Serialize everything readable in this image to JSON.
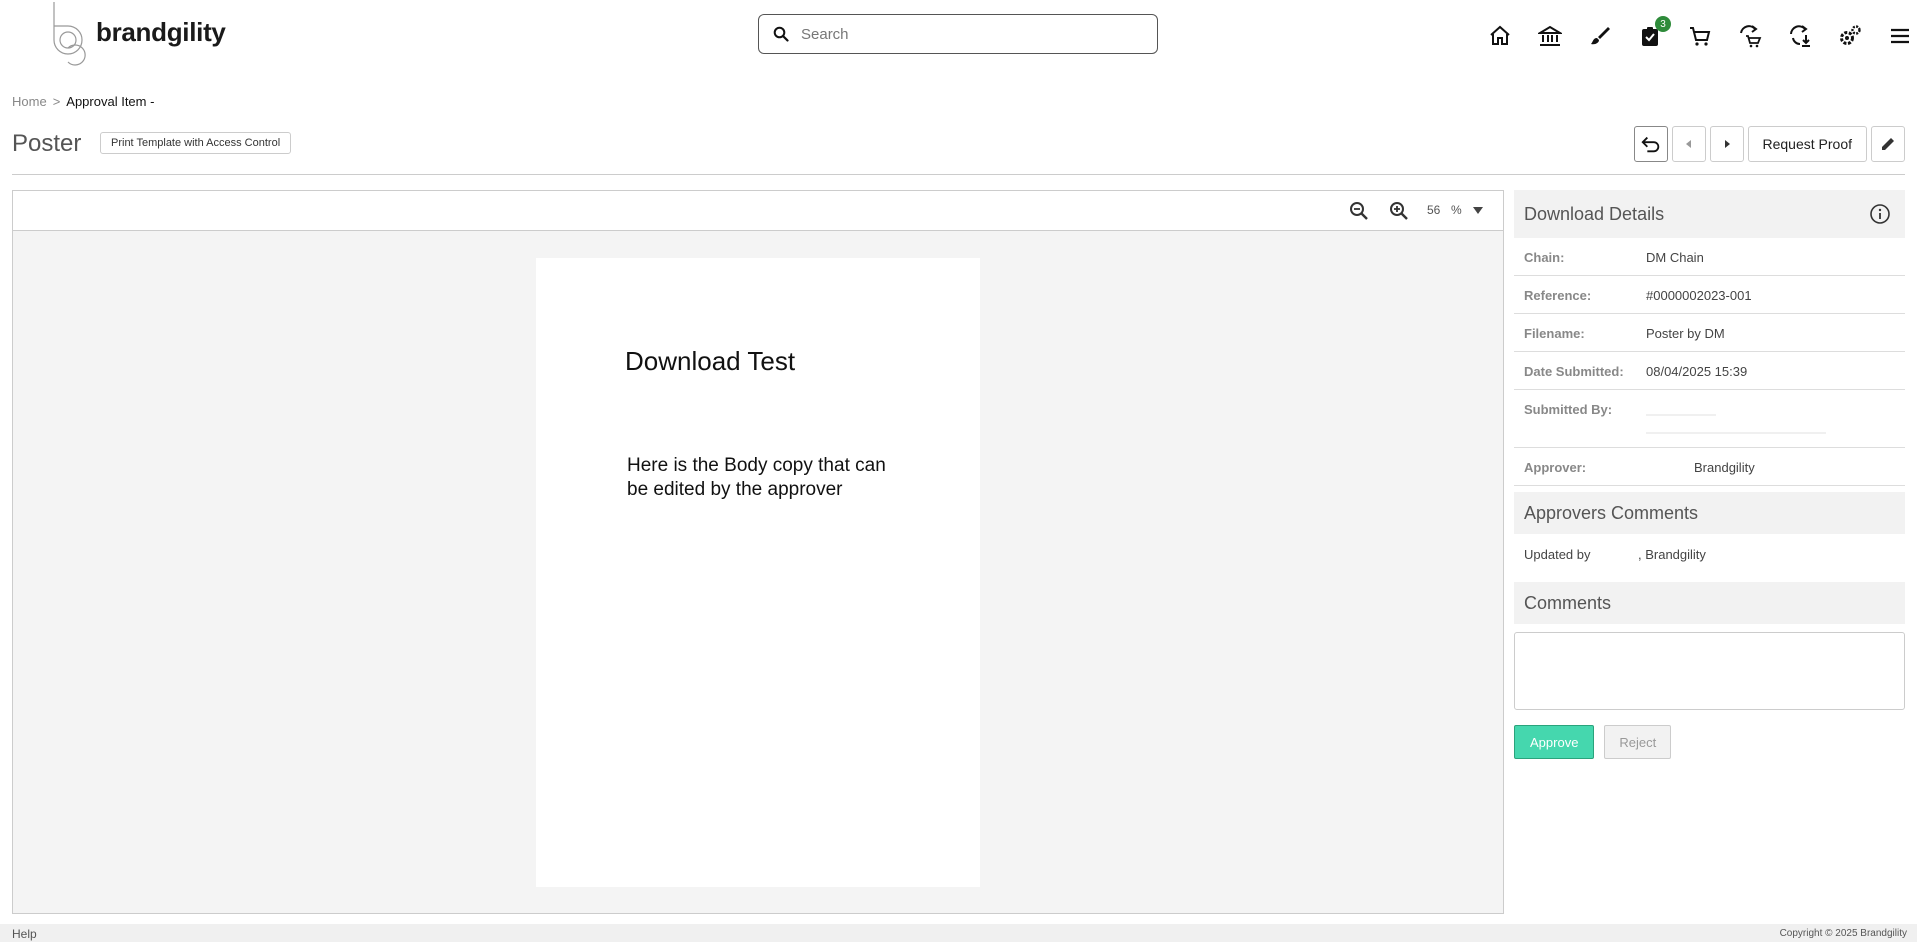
{
  "header": {
    "logo_text": "brandgility",
    "search_placeholder": "Search",
    "nav_icons": [
      "home-icon",
      "bank-icon",
      "brush-icon",
      "tasks-icon",
      "cart-icon",
      "cart-swap-icon",
      "download-swap-icon",
      "gears-icon",
      "menu-icon"
    ],
    "tasks_badge": "3",
    "badge_color": "#2e8b3a"
  },
  "breadcrumb": {
    "home": "Home",
    "separator": ">",
    "current": "Approval Item -"
  },
  "title_row": {
    "title": "Poster",
    "template_tag": "Print Template with Access Control",
    "request_proof_label": "Request Proof"
  },
  "viewer": {
    "zoom_level": "56",
    "zoom_unit": "%",
    "doc_title": "Download Test",
    "doc_body": "Here is the Body copy that can be edited by the approver"
  },
  "details": {
    "title": "Download Details",
    "rows": [
      {
        "label": "Chain:",
        "value": "DM Chain"
      },
      {
        "label": "Reference:",
        "value": "#0000002023-001"
      },
      {
        "label": "Filename:",
        "value": "Poster by DM"
      },
      {
        "label": "Date Submitted:",
        "value": "08/04/2025 15:39"
      },
      {
        "label": "Submitted By:",
        "value": ""
      },
      {
        "label": "Approver:",
        "value": "Brandgility"
      }
    ]
  },
  "approvers_comments": {
    "title": "Approvers Comments",
    "updated_prefix": "Updated by",
    "updated_suffix": ", Brandgility"
  },
  "comments": {
    "title": "Comments",
    "approve_label": "Approve",
    "reject_label": "Reject",
    "approve_color": "#45d7ae"
  },
  "footer": {
    "help": "Help",
    "copyright": "Copyright © 2025 Brandgility"
  }
}
